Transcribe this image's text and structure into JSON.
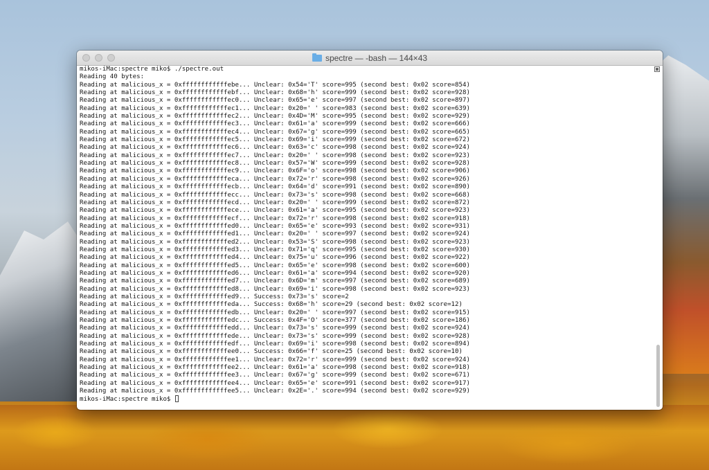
{
  "window": {
    "title": "spectre — -bash — 144×43"
  },
  "terminal": {
    "lines": [
      "mikos-iMac:spectre miko$ ./spectre.out",
      "Reading 40 bytes:",
      "Reading at malicious_x = 0xffffffffffffebe... Unclear: 0x54='T' score=995 (second best: 0x02 score=854)",
      "Reading at malicious_x = 0xffffffffffffebf... Unclear: 0x68='h' score=999 (second best: 0x02 score=928)",
      "Reading at malicious_x = 0xffffffffffffec0... Unclear: 0x65='e' score=997 (second best: 0x02 score=897)",
      "Reading at malicious_x = 0xffffffffffffec1... Unclear: 0x20=' ' score=983 (second best: 0x02 score=639)",
      "Reading at malicious_x = 0xffffffffffffec2... Unclear: 0x4D='M' score=995 (second best: 0x02 score=929)",
      "Reading at malicious_x = 0xffffffffffffec3... Unclear: 0x61='a' score=999 (second best: 0x02 score=666)",
      "Reading at malicious_x = 0xffffffffffffec4... Unclear: 0x67='g' score=999 (second best: 0x02 score=665)",
      "Reading at malicious_x = 0xffffffffffffec5... Unclear: 0x69='i' score=999 (second best: 0x02 score=672)",
      "Reading at malicious_x = 0xffffffffffffec6... Unclear: 0x63='c' score=998 (second best: 0x02 score=924)",
      "Reading at malicious_x = 0xffffffffffffec7... Unclear: 0x20=' ' score=998 (second best: 0x02 score=923)",
      "Reading at malicious_x = 0xffffffffffffec8... Unclear: 0x57='W' score=999 (second best: 0x02 score=928)",
      "Reading at malicious_x = 0xffffffffffffec9... Unclear: 0x6F='o' score=998 (second best: 0x02 score=906)",
      "Reading at malicious_x = 0xffffffffffffeca... Unclear: 0x72='r' score=998 (second best: 0x02 score=926)",
      "Reading at malicious_x = 0xffffffffffffecb... Unclear: 0x64='d' score=991 (second best: 0x02 score=890)",
      "Reading at malicious_x = 0xffffffffffffecc... Unclear: 0x73='s' score=998 (second best: 0x02 score=668)",
      "Reading at malicious_x = 0xffffffffffffecd... Unclear: 0x20=' ' score=999 (second best: 0x02 score=872)",
      "Reading at malicious_x = 0xffffffffffffece... Unclear: 0x61='a' score=995 (second best: 0x02 score=923)",
      "Reading at malicious_x = 0xffffffffffffecf... Unclear: 0x72='r' score=998 (second best: 0x02 score=918)",
      "Reading at malicious_x = 0xffffffffffffed0... Unclear: 0x65='e' score=993 (second best: 0x02 score=931)",
      "Reading at malicious_x = 0xffffffffffffed1... Unclear: 0x20=' ' score=997 (second best: 0x02 score=924)",
      "Reading at malicious_x = 0xffffffffffffed2... Unclear: 0x53='S' score=998 (second best: 0x02 score=923)",
      "Reading at malicious_x = 0xffffffffffffed3... Unclear: 0x71='q' score=995 (second best: 0x02 score=930)",
      "Reading at malicious_x = 0xffffffffffffed4... Unclear: 0x75='u' score=996 (second best: 0x02 score=922)",
      "Reading at malicious_x = 0xffffffffffffed5... Unclear: 0x65='e' score=998 (second best: 0x02 score=600)",
      "Reading at malicious_x = 0xffffffffffffed6... Unclear: 0x61='a' score=994 (second best: 0x02 score=920)",
      "Reading at malicious_x = 0xffffffffffffed7... Unclear: 0x6D='m' score=997 (second best: 0x02 score=689)",
      "Reading at malicious_x = 0xffffffffffffed8... Unclear: 0x69='i' score=998 (second best: 0x02 score=923)",
      "Reading at malicious_x = 0xffffffffffffed9... Success: 0x73='s' score=2",
      "Reading at malicious_x = 0xffffffffffffeda... Success: 0x68='h' score=29 (second best: 0x02 score=12)",
      "Reading at malicious_x = 0xffffffffffffedb... Unclear: 0x20=' ' score=997 (second best: 0x02 score=915)",
      "Reading at malicious_x = 0xffffffffffffedc... Success: 0x4F='O' score=377 (second best: 0x02 score=186)",
      "Reading at malicious_x = 0xffffffffffffedd... Unclear: 0x73='s' score=999 (second best: 0x02 score=924)",
      "Reading at malicious_x = 0xffffffffffffede... Unclear: 0x73='s' score=999 (second best: 0x02 score=928)",
      "Reading at malicious_x = 0xffffffffffffedf... Unclear: 0x69='i' score=998 (second best: 0x02 score=894)",
      "Reading at malicious_x = 0xffffffffffffee0... Success: 0x66='f' score=25 (second best: 0x02 score=10)",
      "Reading at malicious_x = 0xffffffffffffee1... Unclear: 0x72='r' score=999 (second best: 0x02 score=924)",
      "Reading at malicious_x = 0xffffffffffffee2... Unclear: 0x61='a' score=998 (second best: 0x02 score=918)",
      "Reading at malicious_x = 0xffffffffffffee3... Unclear: 0x67='g' score=999 (second best: 0x02 score=671)",
      "Reading at malicious_x = 0xffffffffffffee4... Unclear: 0x65='e' score=991 (second best: 0x02 score=917)",
      "Reading at malicious_x = 0xffffffffffffee5... Unclear: 0x2E='.' score=994 (second best: 0x02 score=929)"
    ],
    "prompt": "mikos-iMac:spectre miko$ "
  },
  "icons": {
    "folder": "folder-icon",
    "cursor": "text-cursor-icon"
  }
}
